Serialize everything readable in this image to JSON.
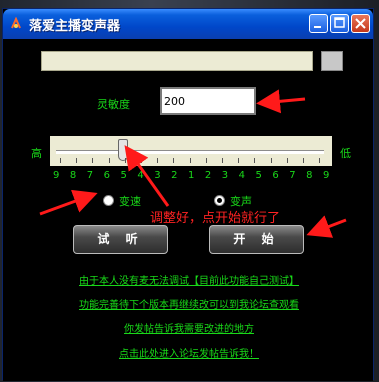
{
  "window": {
    "title": "落爱主播变声器",
    "icon": "app-icon",
    "controls": [
      "minimize-icon",
      "maximize-icon",
      "close-icon"
    ]
  },
  "path_field": {
    "value": ""
  },
  "sensitivity": {
    "label": "灵敏度",
    "value": "200"
  },
  "slider": {
    "left_label": "高",
    "right_label": "低",
    "level_percent": 25,
    "scale": [
      "9",
      "8",
      "7",
      "6",
      "5",
      "4",
      "3",
      "2",
      "1",
      "2",
      "3",
      "4",
      "5",
      "6",
      "7",
      "8",
      "9"
    ]
  },
  "mode": {
    "options": [
      {
        "label": "变速",
        "checked": false
      },
      {
        "label": "变声",
        "checked": true
      }
    ]
  },
  "buttons": {
    "try": "试 听",
    "start": "开 始"
  },
  "annotation": "调整好，点开始就行了",
  "links": [
    "由于本人没有麦无法调试【目前此功能自己测试】",
    "功能完善待下个版本再继续改可以到我论坛查观看",
    "你发帖告诉我需要改进的地方",
    "点击此处进入论坛发帖告诉我！"
  ],
  "colors": {
    "accent_green": "#19d919",
    "annotation_red": "#ff2222",
    "titlebar_blue": "#0047c9"
  }
}
